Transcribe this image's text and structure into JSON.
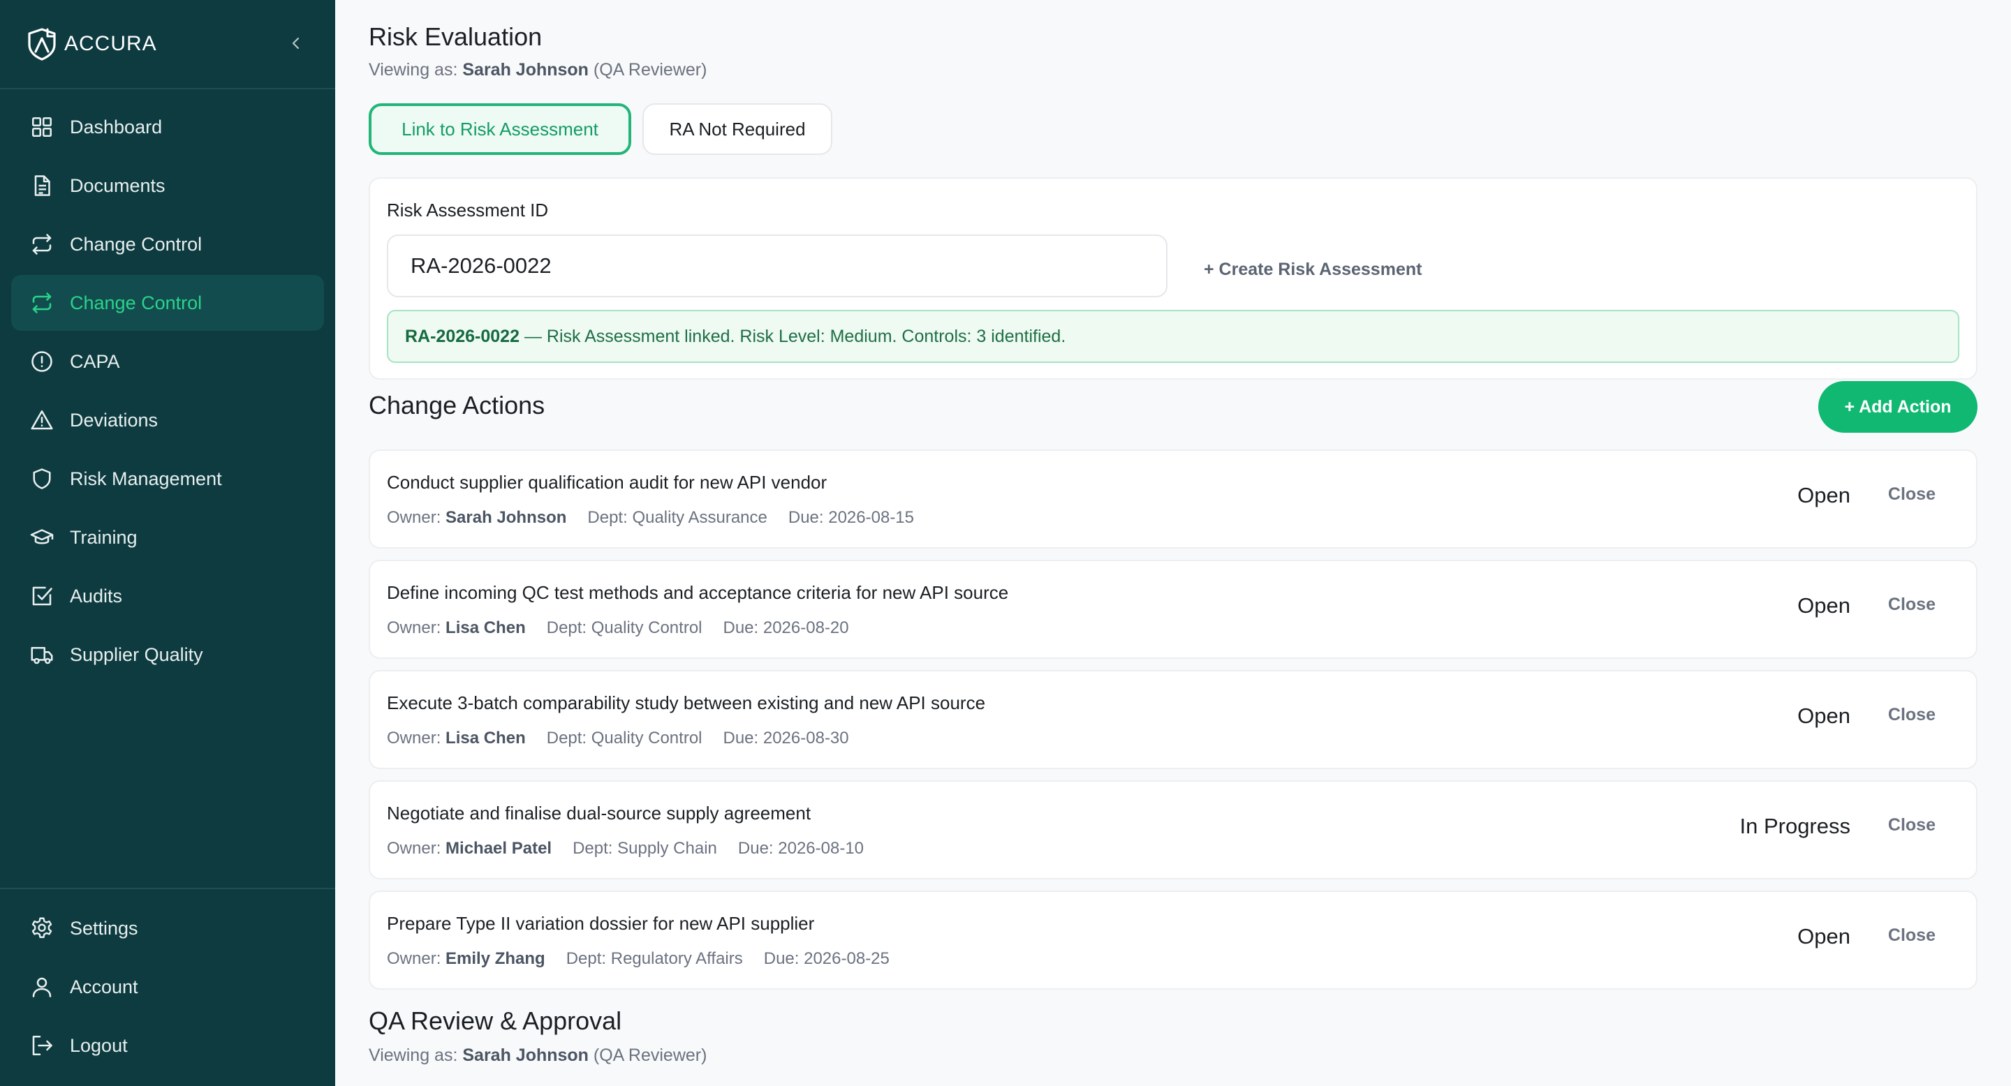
{
  "brand": {
    "name": "ACCURA"
  },
  "sidebar": {
    "items": [
      {
        "label": "Dashboard",
        "icon": "dashboard-icon"
      },
      {
        "label": "Documents",
        "icon": "document-icon"
      },
      {
        "label": "Change Control",
        "icon": "arrows-exchange-icon"
      },
      {
        "label": "Change Control",
        "icon": "arrows-exchange-icon",
        "active": true
      },
      {
        "label": "CAPA",
        "icon": "alert-circle-icon"
      },
      {
        "label": "Deviations",
        "icon": "warning-triangle-icon"
      },
      {
        "label": "Risk Management",
        "icon": "shield-icon"
      },
      {
        "label": "Training",
        "icon": "graduation-cap-icon"
      },
      {
        "label": "Audits",
        "icon": "checkbox-icon"
      },
      {
        "label": "Supplier Quality",
        "icon": "truck-icon"
      }
    ],
    "bottom_items": [
      {
        "label": "Settings",
        "icon": "gear-icon"
      },
      {
        "label": "Account",
        "icon": "user-icon"
      },
      {
        "label": "Logout",
        "icon": "logout-icon"
      }
    ],
    "accent_color": "#2bd38b",
    "background_color": "#0d3b40"
  },
  "risk_evaluation": {
    "title": "Risk Evaluation",
    "viewing_prefix": "Viewing as:",
    "viewer_name": "Sarah Johnson",
    "viewer_role": "(QA Reviewer)",
    "link_button": "Link to Risk Assessment",
    "not_required_button": "RA Not Required",
    "ra_id_label": "Risk Assessment ID",
    "ra_id_value": "RA-2026-0022",
    "create_link": "+ Create Risk Assessment",
    "notice_id": "RA-2026-0022",
    "notice_text": "— Risk Assessment linked. Risk Level: Medium. Controls: 3 identified."
  },
  "change_actions": {
    "title": "Change Actions",
    "add_button": "+ Add Action",
    "owner_label": "Owner:",
    "close_label": "Close",
    "items": [
      {
        "title": "Conduct supplier qualification audit for new API vendor",
        "owner": "Sarah Johnson",
        "dept": "Dept: Quality Assurance",
        "due": "Due: 2026-08-15",
        "status": "Open"
      },
      {
        "title": "Define incoming QC test methods and acceptance criteria for new API source",
        "owner": "Lisa Chen",
        "dept": "Dept: Quality Control",
        "due": "Due: 2026-08-20",
        "status": "Open"
      },
      {
        "title": "Execute 3-batch comparability study between existing and new API source",
        "owner": "Lisa Chen",
        "dept": "Dept: Quality Control",
        "due": "Due: 2026-08-30",
        "status": "Open"
      },
      {
        "title": "Negotiate and finalise dual-source supply agreement",
        "owner": "Michael Patel",
        "dept": "Dept: Supply Chain",
        "due": "Due: 2026-08-10",
        "status": "In Progress"
      },
      {
        "title": "Prepare Type II variation dossier for new API supplier",
        "owner": "Emily Zhang",
        "dept": "Dept: Regulatory Affairs",
        "due": "Due: 2026-08-25",
        "status": "Open"
      }
    ]
  },
  "qa_review": {
    "title": "QA Review & Approval",
    "viewing_prefix": "Viewing as:",
    "viewer_name": "Sarah Johnson",
    "viewer_role": "(QA Reviewer)"
  },
  "colors": {
    "primary_green": "#10b872",
    "link_border": "#22b57a",
    "notice_bg": "#eefaf2"
  }
}
